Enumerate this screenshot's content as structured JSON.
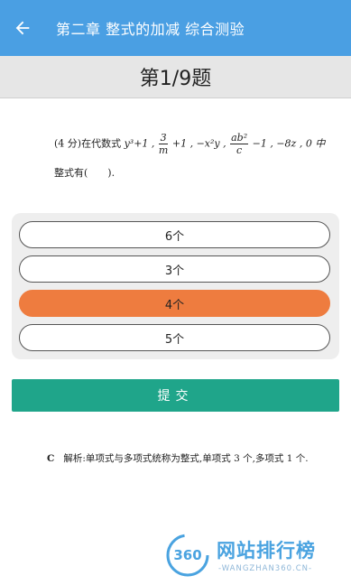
{
  "appbar": {
    "title": "第二章 整式的加减 综合测验",
    "back_icon": "arrow-left-icon"
  },
  "question_header": {
    "label": "第1/9题"
  },
  "question": {
    "prefix": "(4 分)在代数式",
    "term1": "y³+1 ,",
    "frac1_num": "3",
    "frac1_den": "m",
    "term2": "+1 , −x²y ,",
    "frac2_num": "ab²",
    "frac2_den": "c",
    "term3": "−1 , −8z , 0 中",
    "line2": "整式有(　　)."
  },
  "options": [
    {
      "label": "6个",
      "selected": false
    },
    {
      "label": "3个",
      "selected": false
    },
    {
      "label": "4个",
      "selected": true
    },
    {
      "label": "5个",
      "selected": false
    }
  ],
  "submit": {
    "label": "提交"
  },
  "analysis": {
    "answer": "C",
    "text": "解析:单项式与多项式统称为整式,单项式 3 个,多项式 1 个."
  },
  "watermark": {
    "logo_text": "360",
    "title": "网站排行榜",
    "subtitle": "-WANGZHAN360.CN-"
  },
  "colors": {
    "appbar": "#4a9fe3",
    "selected_option": "#ee7c3f",
    "submit": "#1fa58a"
  }
}
